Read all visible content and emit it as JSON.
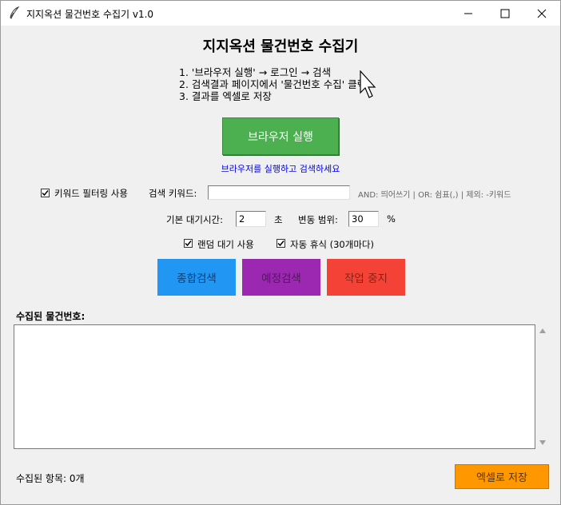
{
  "window": {
    "title": "지지옥션 물건번호 수집기 v1.0"
  },
  "app": {
    "heading": "지지옥션 물건번호 수집기",
    "instructions": [
      "1. '브라우저 실행' → 로그인 → 검색",
      "2. 검색결과 페이지에서 '물건번호 수집' 클릭",
      "3. 결과를 엑셀로 저장"
    ],
    "launch_button": "브라우저 실행",
    "hint": "브라우저를 실행하고 검색하세요"
  },
  "filter": {
    "enabled_label": "키워드 필터링 사용",
    "enabled": true,
    "keyword_label": "검색 키워드:",
    "keyword_value": "",
    "syntax_hint": "AND: 띄어쓰기 | OR: 쉼표(,) | 제외: -키워드"
  },
  "timing": {
    "base_wait_label": "기본 대기시간:",
    "base_wait_value": "2",
    "base_wait_unit": "초",
    "variance_label": "변동 범위:",
    "variance_value": "30",
    "variance_unit": "%"
  },
  "options": {
    "random_wait_label": "랜덤 대기 사용",
    "random_wait": true,
    "auto_rest_label": "자동 휴식 (30개마다)",
    "auto_rest": true
  },
  "actions": {
    "general_search": "종합검색",
    "preview_search": "예정검색",
    "stop_job": "작업 중지"
  },
  "results": {
    "section_label": "수집된 물건번호:",
    "content": "",
    "count_text": "수집된 항목: 0개",
    "save_button": "엑셀로 저장"
  },
  "colors": {
    "launch": "#4caf50",
    "general_search": "#2196f3",
    "preview_search": "#9c27b0",
    "stop": "#f44336",
    "save": "#ff9800",
    "hint": "#0000ee"
  }
}
